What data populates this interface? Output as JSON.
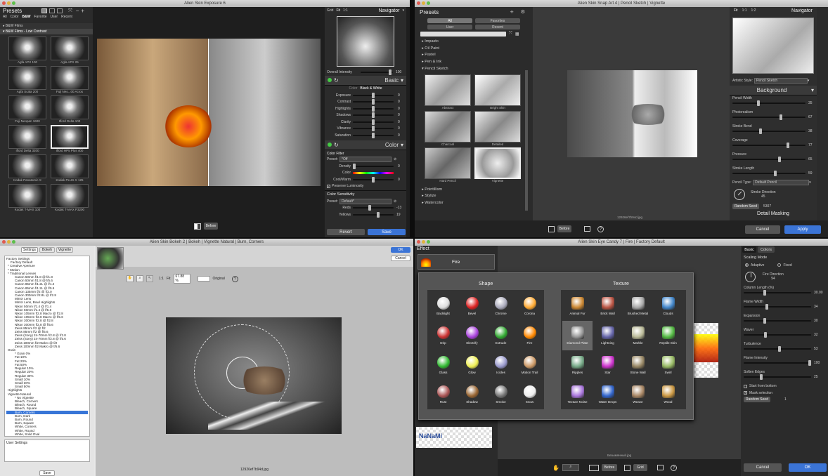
{
  "exposure": {
    "title": "Alien Skin Exposure 6",
    "presets_label": "Presets",
    "filter_tabs": [
      "All",
      "Color",
      "B&W",
      "Favorite",
      "User",
      "Recent"
    ],
    "groups": [
      "B&W Films",
      "B&W Films - Low Contrast"
    ],
    "thumbs": [
      "Agfa APX 100",
      "Agfa APX 25",
      "Agfa Scala 200",
      "Fuji Neo...00 Acros",
      "Fuji Neopan 1600",
      "Ilford Delta 100",
      "Ilford Delta 3200",
      "Ilford HP5 Plus 400",
      "Kodak Panatomic-X",
      "Kodak PLUS-X 125",
      "Kodak T-MAX 100",
      "Kodak T-MAX P3200"
    ],
    "view_modes": [
      "Grid",
      "Fit",
      "1:1"
    ],
    "navigator": "Navigator",
    "overall": "Overall Intensity",
    "overall_val": "100",
    "basic": "Basic",
    "color_tab": "Color",
    "bw_tab": "Black & White",
    "sliders": [
      {
        "l": "Exposure",
        "v": "0"
      },
      {
        "l": "Contrast",
        "v": "0"
      },
      {
        "l": "Highlights",
        "v": "0"
      },
      {
        "l": "Shadows",
        "v": "0"
      },
      {
        "l": "Clarity",
        "v": "0"
      },
      {
        "l": "Vibrance",
        "v": "0"
      },
      {
        "l": "Saturation",
        "v": "0"
      }
    ],
    "color_section": "Color",
    "color_filter": "Color Filter",
    "preset_label": "Preset:",
    "preset_value": "*Off",
    "density": "Density",
    "density_val": "0",
    "color_label": "Color",
    "coolwarm": "Cool/Warm",
    "coolwarm_val": "0",
    "preserve": "Preserve Luminosity",
    "color_sens": "Color Sensitivity",
    "cs_preset": "Default*",
    "reds": "Reds",
    "reds_val": "-13",
    "yellows": "Yellows",
    "yellows_val": "19",
    "revert": "Revert",
    "save": "Save",
    "before": "Before"
  },
  "snap": {
    "title": "Alien Skin Snap Art 4 | Pencil Sketch | Vignette",
    "presets_label": "Presets",
    "chips": [
      "All",
      "Favorites",
      "User",
      "Recent"
    ],
    "categories_top": [
      "Impasto",
      "Oil Paint",
      "Pastel",
      "Pen & Ink",
      "Pencil Sketch"
    ],
    "thumbs": [
      "Abstract",
      "Bright Skin",
      "Charcoal",
      "Detailed",
      "Hard Pencil",
      "Vignette"
    ],
    "categories_bottom": [
      "Pointillism",
      "Stylize",
      "Watercolor"
    ],
    "view_modes": [
      "Fit",
      "1:1",
      "1:2"
    ],
    "navigator": "Navigator",
    "artistic_style_label": "Artistic Style:",
    "artistic_style_value": "Pencil Sketch",
    "background": "Background",
    "sliders": [
      {
        "l": "Pencil Width",
        "v": "35"
      },
      {
        "l": "Photorealism",
        "v": "67"
      },
      {
        "l": "Stroke Bend",
        "v": "38"
      },
      {
        "l": "Coverage",
        "v": "77"
      },
      {
        "l": "Pressure",
        "v": "65"
      },
      {
        "l": "Stroke Length",
        "v": "59"
      }
    ],
    "pencil_type_label": "Pencil Type:",
    "pencil_type_value": "Default Pencil",
    "stroke_dir": "Stroke Direction",
    "stroke_dir_val": "45",
    "random_seed": "Random Seed",
    "seed_val": "5307",
    "detail_masking": "Detail Masking",
    "filename": "12926ef7b94d.jpg",
    "before": "Before",
    "cancel": "Cancel",
    "apply": "Apply"
  },
  "bokeh": {
    "title": "Alien Skin Bokeh 2 | Bokeh | Vignette Natural | Burn, Corners",
    "tabs": [
      "Settings",
      "Bokeh",
      "Vignette"
    ],
    "tree": [
      "Factory Settings",
      "Factory Default",
      "* Creative Aperture",
      "* Motion",
      "* Traditional Lenses",
      "Canon 50mm f/1.8 @ f/1.8",
      "Canon 50mm f/1.8 @ f/5.6",
      "Canon 85mm f/1.2L @ f/1.2",
      "Canon 85mm f/1.2L @ f/5.6",
      "Canon 135mm f/2 @ f/2.0",
      "Canon 300mm f/2.8L @ f/2.8",
      "Mirror Lens",
      "Mirror Lens, Bowl Highlights",
      "Nikon 50mm f/1.4 @ f/1.4",
      "Nikon 50mm f/1.4 @ f/5.6",
      "Nikon 105mm f/2.8 Macro @ f/2.8",
      "Nikon 105mm f/2.8 Macro @ f/5.6",
      "Nikon 300mm f/2.8 @ f/2.8",
      "Nikon 300mm f/2.8 @ f/5.6",
      "Zeiss 85mm f/2 @ f/2",
      "Zeiss 85mm f/2 @ f/5.6",
      "Zeiss (Sony) 24-70mm f/2.8 @ f/2.8",
      "Zeiss (Sony) 24-70mm f/2.8 @ f/5.6",
      "Zeiss 100mm f/2 Makro @ f/2",
      "Zeiss 100mm f/2 Makro @ f/5.6",
      "Grain",
      "* Grain 0%",
      "Fat 10%",
      "Fat 20%",
      "Fat 50%",
      "Regular 10%",
      "Regular 20%",
      "Regular 30%",
      "Small 10%",
      "Small 30%",
      "Small 50%",
      "Highlights",
      "Vignette Natural",
      "* No Vignette",
      "Bleach, Corners",
      "Bleach, Round",
      "Bleach, Square",
      "Burn, Corners",
      "Burn, Dark",
      "Burn, Round",
      "Burn, Square",
      "White, Corners",
      "White, Round",
      "White, Solid Oval",
      "White, Solid Square",
      "White, Square",
      "Vignette Region-Based"
    ],
    "selected_index": 42,
    "user_settings": "User Settings",
    "save": "Save",
    "ok": "OK",
    "cancel": "Cancel",
    "zoom_1": "1:1",
    "fit": "Fit",
    "zoom": "67.88 %",
    "original": "Original",
    "filename": "12926ef7b94d.jpg"
  },
  "candy": {
    "title": "Alien Skin Eye Candy 7 | Fire | Factory Default",
    "effect": "Effect",
    "effect_current": "Fire",
    "shape": "Shape",
    "texture": "Texture",
    "shape_items": [
      "Backlight",
      "Bevel",
      "Chrome",
      "Corona",
      "Drip",
      "Electrify",
      "Extrude",
      "Fire",
      "Glass",
      "Glow",
      "Icicles",
      "Motion Trail",
      "Rust",
      "Shadow",
      "Smoke",
      "Snow"
    ],
    "texture_items": [
      "Animal Fur",
      "Brick Wall",
      "Brushed Metal",
      "Clouds",
      "Diamond Plate",
      "Lightning",
      "Marble",
      "Reptile Skin",
      "Ripples",
      "Star",
      "Stone Wall",
      "Swirl",
      "Texture Noise",
      "Water Drops",
      "Weave",
      "Wood"
    ],
    "tabs": [
      "Basic",
      "Colors"
    ],
    "scaling": "Scaling Mode",
    "adaptive": "Adaptive",
    "fixed": "Fixed",
    "fire_dir": "Fire Direction",
    "fire_dir_val": "94",
    "sliders": [
      {
        "l": "Column Length (%)",
        "v": "30.00"
      },
      {
        "l": "Flame Width",
        "v": "34"
      },
      {
        "l": "Expansion",
        "v": "30"
      },
      {
        "l": "Waver",
        "v": "32"
      },
      {
        "l": "Turbulence",
        "v": "53"
      },
      {
        "l": "Flame Intensity",
        "v": "100"
      },
      {
        "l": "Soften Edges",
        "v": "25"
      }
    ],
    "start_bottom": "Start from bottom",
    "mask_sel": "Mask selection",
    "random_seed": "Random Seed",
    "seed_val": "1",
    "logo_text": "NaNaMi",
    "filename": "Безымянный.jpg",
    "before": "Before",
    "grid": "Grid",
    "cancel": "Cancel",
    "ok": "OK"
  },
  "colors": {
    "accent": "#3b74d6",
    "panel": "#2b2b2b",
    "selection": "#3875d7"
  }
}
